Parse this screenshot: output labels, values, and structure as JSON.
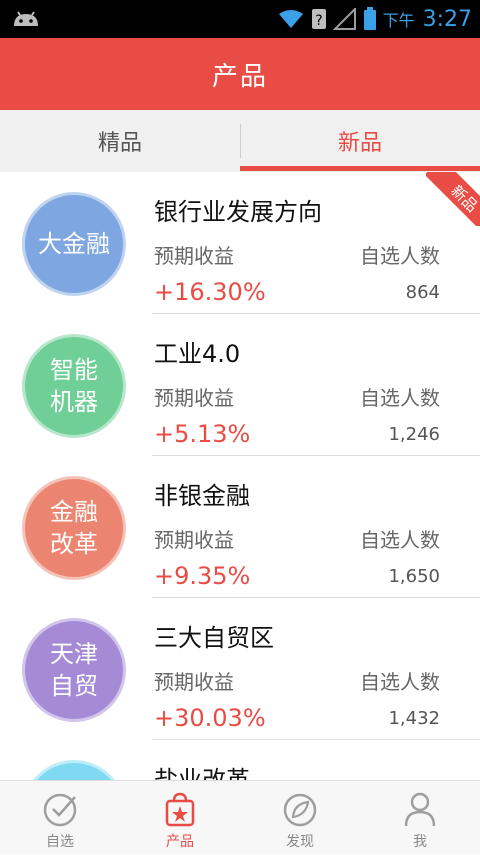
{
  "status_bar": {
    "ampm": "下午",
    "time": "3:27",
    "icons": [
      "android-icon",
      "wifi-icon",
      "unknown-sim-icon",
      "signal-icon",
      "battery-icon"
    ]
  },
  "header": {
    "title": "产品"
  },
  "tabs": [
    {
      "label": "精品",
      "active": false
    },
    {
      "label": "新品",
      "active": true
    }
  ],
  "list_labels": {
    "yield_label": "预期收益",
    "count_label": "自选人数"
  },
  "products": [
    {
      "badge": "大金融",
      "title": "银行业发展方向",
      "yield": "+16.30%",
      "count": "864",
      "color": "#7ea6e0",
      "new": true,
      "new_label": "新品"
    },
    {
      "badge": "智能\n机器",
      "title": "工业4.0",
      "yield": "+5.13%",
      "count": "1,246",
      "color": "#6fcf97",
      "new": false
    },
    {
      "badge": "金融\n改革",
      "title": "非银金融",
      "yield": "+9.35%",
      "count": "1,650",
      "color": "#eb8470",
      "new": false
    },
    {
      "badge": "天津\n自贸",
      "title": "三大自贸区",
      "yield": "+30.03%",
      "count": "1,432",
      "color": "#a58bd6",
      "new": false
    },
    {
      "badge": "",
      "title": "盐业改革",
      "color": "#7fd9f2",
      "new": false
    }
  ],
  "bottom_nav": [
    {
      "label": "自选",
      "icon": "check-circle-icon",
      "active": false
    },
    {
      "label": "产品",
      "icon": "bag-star-icon",
      "active": true
    },
    {
      "label": "发现",
      "icon": "compass-leaf-icon",
      "active": false
    },
    {
      "label": "我",
      "icon": "person-icon",
      "active": false
    }
  ],
  "colors": {
    "accent": "#e84c44",
    "header_bg": "#e84c44"
  }
}
